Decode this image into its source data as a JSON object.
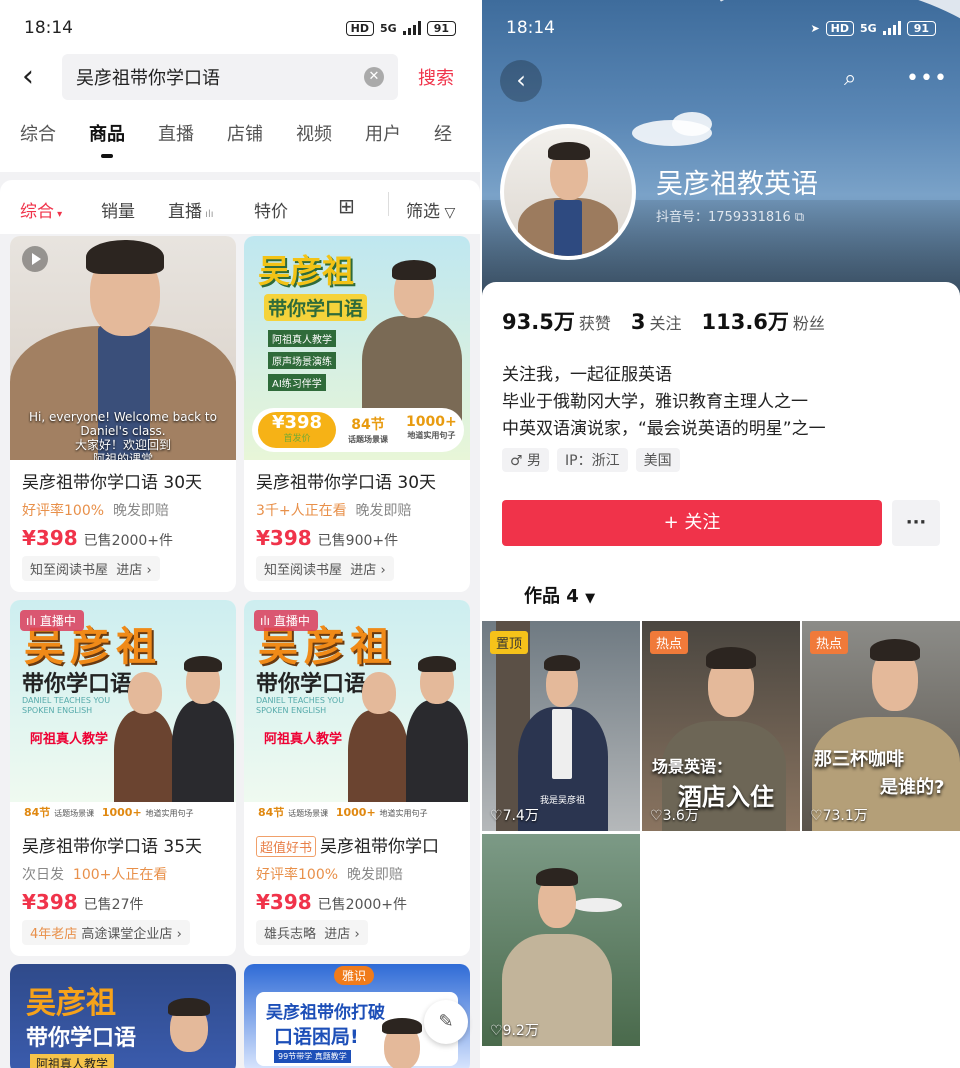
{
  "left": {
    "status": {
      "time": "18:14",
      "hd": "HD",
      "net": "5G",
      "battery": "91"
    },
    "search": {
      "query": "吴彦祖带你学口语",
      "button": "搜索"
    },
    "tabs": [
      "综合",
      "商品",
      "直播",
      "店铺",
      "视频",
      "用户",
      "经"
    ],
    "filters": {
      "comprehensive": "综合",
      "sales": "销量",
      "live": "直播",
      "sale": "特价",
      "filter": "筛选"
    },
    "products": [
      {
        "title": "吴彦祖带你学口语 30天",
        "sub": "好评率100%",
        "sub2": "晚发即赔",
        "price": "¥398",
        "sold": "已售2000+件",
        "shop": "知至阅读书屋",
        "enter": "进店",
        "caption1": "Hi, everyone! Welcome back to",
        "caption2": "Daniel's class.",
        "caption3": "大家好！欢迎回到",
        "caption4": "阿祖的课堂"
      },
      {
        "title": "吴彦祖带你学口语 30天",
        "sub": "3千+人正在看",
        "sub2": "晚发即赔",
        "price": "¥398",
        "sold": "已售900+件",
        "shop": "知至阅读书屋",
        "enter": "进店",
        "poster_name": "吴彦祖",
        "poster_sub": "带你学口语",
        "b1": "阿祖真人教学",
        "b2": "原声场景演练",
        "b3": "AI练习伴学",
        "poster_price": "¥398",
        "poster_price_label": "首发价",
        "lessons": "84节",
        "lessons_label": "话题场景课",
        "sentences": "1000+",
        "sentences_label": "地道实用句子"
      },
      {
        "title": "吴彦祖带你学口语 35天",
        "sub": "次日发",
        "sub2": "100+人正在看",
        "price": "¥398",
        "sold": "已售27件",
        "shop_badge": "4年老店",
        "shop": "高途课堂企业店",
        "live": "直播中",
        "poster_name": "吴彦祖",
        "poster_sub": "带你学口语",
        "poster_en": "DANIEL TEACHES YOU SPOKEN ENGLISH",
        "poster_tag": "阿祖真人教学",
        "lessons": "84节",
        "lessons_label": "话题场景课",
        "sentences": "1000+",
        "sentences_label": "地道实用句子"
      },
      {
        "title": "吴彦祖带你学口",
        "title_badge": "超值好书",
        "sub": "好评率100%",
        "sub2": "晚发即赔",
        "price": "¥398",
        "sold": "已售2000+件",
        "shop": "雄兵志略",
        "enter": "进店",
        "live": "直播中",
        "poster_name": "吴彦祖",
        "poster_sub": "带你学口语",
        "poster_en": "DANIEL TEACHES YOU SPOKEN ENGLISH",
        "poster_tag": "阿祖真人教学",
        "lessons": "84节",
        "lessons_label": "话题场景课",
        "sentences": "1000+",
        "sentences_label": "地道实用句子"
      },
      {
        "poster_name": "吴彦祖",
        "poster_sub": "带你学口语",
        "poster_tag": "阿祖真人教学"
      },
      {
        "brand": "雅识",
        "headline1": "吴彦祖带你打破",
        "headline2": "口语困局!",
        "small": "99节带学 真题教学"
      }
    ]
  },
  "right": {
    "status": {
      "time": "18:14",
      "hd": "HD",
      "net": "5G",
      "battery": "91"
    },
    "profile": {
      "name": "吴彦祖教英语",
      "id": "抖音号：1759331816"
    },
    "stats": {
      "likes": "93.5万",
      "likes_label": "获赞",
      "following": "3",
      "following_label": "关注",
      "fans": "113.6万",
      "fans_label": "粉丝"
    },
    "bio": [
      "关注我，一起征服英语",
      "毕业于俄勒冈大学，雅识教育主理人之一",
      "中英双语演说家，“最会说英语的明星”之一"
    ],
    "tags": [
      "♂ 男",
      "IP：浙江",
      "美国"
    ],
    "follow": "+ 关注",
    "works_label": "作品 4",
    "videos": [
      {
        "tag": "置顶",
        "likes": "7.4万",
        "caption": "我是吴彦祖"
      },
      {
        "tag": "热点",
        "likes": "3.6万",
        "overlay1": "场景英语：",
        "overlay2": "酒店入住"
      },
      {
        "tag": "热点",
        "likes": "73.1万",
        "overlay1": "那三杯咖啡",
        "overlay2": "是谁的?"
      },
      {
        "likes": "9.2万"
      }
    ]
  }
}
